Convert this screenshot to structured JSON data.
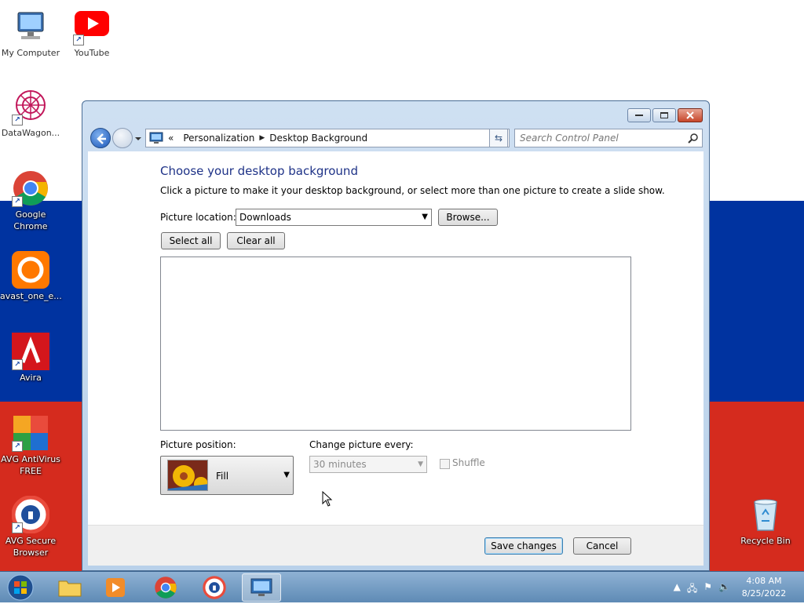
{
  "desktop": {
    "icons": [
      {
        "label": "My Computer"
      },
      {
        "label": "YouTube"
      },
      {
        "label": "DataWagon..."
      },
      {
        "label": "Google Chrome"
      },
      {
        "label": "avast_one_e..."
      },
      {
        "label": "Avira"
      },
      {
        "label": "AVG AntiVirus FREE"
      },
      {
        "label": "AVG Secure Browser"
      },
      {
        "label": "Recycle Bin"
      }
    ]
  },
  "window": {
    "breadcrumb": {
      "chevrons": "«",
      "part1": "Personalization",
      "part2": "Desktop Background"
    },
    "search_placeholder": "Search Control Panel",
    "heading": "Choose your desktop background",
    "description": "Click a picture to make it your desktop background, or select more than one picture to create a slide show.",
    "picture_location_label": "Picture location:",
    "picture_location_value": "Downloads",
    "browse_label": "Browse...",
    "select_all_label": "Select all",
    "clear_all_label": "Clear all",
    "picture_position_label": "Picture position:",
    "picture_position_value": "Fill",
    "change_picture_label": "Change picture every:",
    "change_picture_value": "30 minutes",
    "shuffle_label": "Shuffle",
    "save_label": "Save changes",
    "cancel_label": "Cancel"
  },
  "taskbar": {
    "time": "4:08 AM",
    "date": "8/25/2022"
  }
}
